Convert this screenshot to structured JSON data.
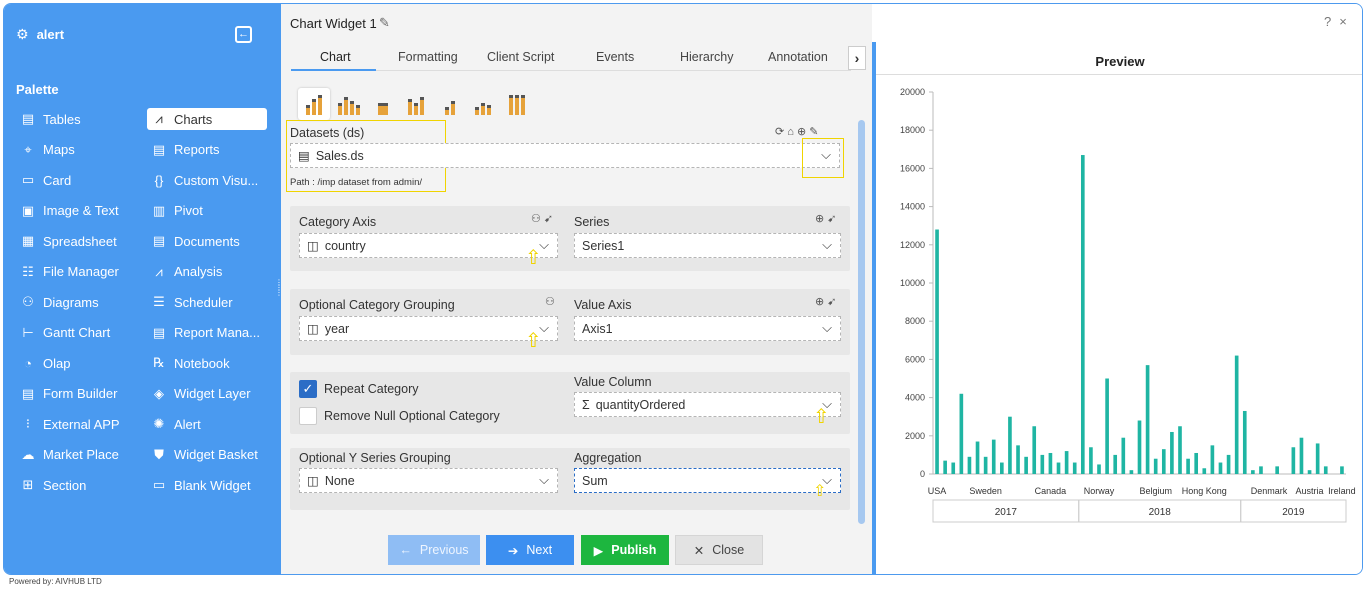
{
  "sidebar": {
    "brand": "alert",
    "palette_title": "Palette",
    "items_left": [
      {
        "label": "Tables",
        "icon": "table-icon",
        "glyph": "▤"
      },
      {
        "label": "Maps",
        "icon": "map-icon",
        "glyph": "⌖"
      },
      {
        "label": "Card",
        "icon": "card-icon",
        "glyph": "▭"
      },
      {
        "label": "Image & Text",
        "icon": "image-icon",
        "glyph": "▣"
      },
      {
        "label": "Spreadsheet",
        "icon": "spreadsheet-icon",
        "glyph": "▦"
      },
      {
        "label": "File Manager",
        "icon": "file-manager-icon",
        "glyph": "☷"
      },
      {
        "label": "Diagrams",
        "icon": "diagram-icon",
        "glyph": "⚇"
      },
      {
        "label": "Gantt Chart",
        "icon": "gantt-icon",
        "glyph": "⊢"
      },
      {
        "label": "Olap",
        "icon": "olap-icon",
        "glyph": "◔"
      },
      {
        "label": "Form Builder",
        "icon": "form-icon",
        "glyph": "▤"
      },
      {
        "label": "External APP",
        "icon": "external-app-icon",
        "glyph": "⁝"
      },
      {
        "label": "Market Place",
        "icon": "cloud-icon",
        "glyph": "☁"
      },
      {
        "label": "Section",
        "icon": "section-icon",
        "glyph": "⊞"
      }
    ],
    "items_right": [
      {
        "label": "Charts",
        "icon": "chart-icon",
        "glyph": "⩘",
        "active": true
      },
      {
        "label": "Reports",
        "icon": "report-icon",
        "glyph": "▤"
      },
      {
        "label": "Custom Visu...",
        "icon": "custom-visual-icon",
        "glyph": "{}"
      },
      {
        "label": "Pivot",
        "icon": "pivot-icon",
        "glyph": "▥"
      },
      {
        "label": "Documents",
        "icon": "document-icon",
        "glyph": "▤"
      },
      {
        "label": "Analysis",
        "icon": "analysis-icon",
        "glyph": "⩘"
      },
      {
        "label": "Scheduler",
        "icon": "scheduler-icon",
        "glyph": "☰"
      },
      {
        "label": "Report Mana...",
        "icon": "report-manager-icon",
        "glyph": "▤"
      },
      {
        "label": "Notebook",
        "icon": "notebook-icon",
        "glyph": "℞"
      },
      {
        "label": "Widget Layer",
        "icon": "layers-icon",
        "glyph": "◈"
      },
      {
        "label": "Alert",
        "icon": "bulb-icon",
        "glyph": "✺"
      },
      {
        "label": "Widget Basket",
        "icon": "basket-icon",
        "glyph": "⛊"
      },
      {
        "label": "Blank Widget",
        "icon": "blank-widget-icon",
        "glyph": "▭"
      }
    ],
    "powered_by": "Powered by: AIVHUB LTD"
  },
  "editor": {
    "title": "Chart Widget 1",
    "tabs": [
      "Chart",
      "Formatting",
      "Client Script",
      "Events",
      "Hierarchy",
      "Annotation"
    ],
    "datasets_label": "Datasets (ds)",
    "dataset_value": "Sales.ds",
    "path": "Path : /imp dataset from admin/",
    "category_axis_label": "Category Axis",
    "category_axis_value": "country",
    "series_label": "Series",
    "series_value": "Series1",
    "opt_category_label": "Optional Category Grouping",
    "opt_category_value": "year",
    "value_axis_label": "Value Axis",
    "value_axis_value": "Axis1",
    "repeat_category_label": "Repeat Category",
    "remove_null_label": "Remove Null Optional Category",
    "value_column_label": "Value Column",
    "value_column_value": "quantityOrdered",
    "opt_y_series_label": "Optional Y Series Grouping",
    "opt_y_series_value": "None",
    "aggregation_label": "Aggregation",
    "aggregation_value": "Sum",
    "buttons": {
      "previous": "Previous",
      "next": "Next",
      "publish": "Publish",
      "close": "Close"
    }
  },
  "preview": {
    "title": "Preview",
    "win_help": "?",
    "win_close": "×"
  },
  "chart_data": {
    "type": "bar",
    "title": "",
    "color": "#1fb5a3",
    "ylim": [
      0,
      20000
    ],
    "yticks": [
      0,
      2000,
      4000,
      6000,
      8000,
      10000,
      12000,
      14000,
      16000,
      18000,
      20000
    ],
    "groups": [
      {
        "label": "2017",
        "values": [
          12800,
          700,
          600,
          4200,
          900,
          1700,
          900,
          1800,
          600,
          3000,
          1500,
          900,
          2500,
          1000,
          1100,
          600,
          1200,
          600
        ],
        "ticks": [
          {
            "label": "USA",
            "index": 0
          },
          {
            "label": "Sweden",
            "index": 6
          },
          {
            "label": "Canada",
            "index": 14
          }
        ]
      },
      {
        "label": "2018",
        "values": [
          16700,
          1400,
          500,
          5000,
          1000,
          1900,
          200,
          2800,
          5700,
          800,
          1300,
          2200,
          2500,
          800,
          1100,
          300,
          1500,
          600,
          1000,
          6200
        ],
        "ticks": [
          {
            "label": "Norway",
            "index": 2
          },
          {
            "label": "Belgium",
            "index": 9
          },
          {
            "label": "Hong Kong",
            "index": 15
          }
        ]
      },
      {
        "label": "2019",
        "values": [
          3300,
          200,
          400,
          0,
          400,
          0,
          1400,
          1900,
          200,
          1600,
          400,
          0,
          400
        ],
        "ticks": [
          {
            "label": "Denmark",
            "index": 3
          },
          {
            "label": "Austria",
            "index": 8
          },
          {
            "label": "Ireland",
            "index": 12
          }
        ]
      }
    ]
  }
}
